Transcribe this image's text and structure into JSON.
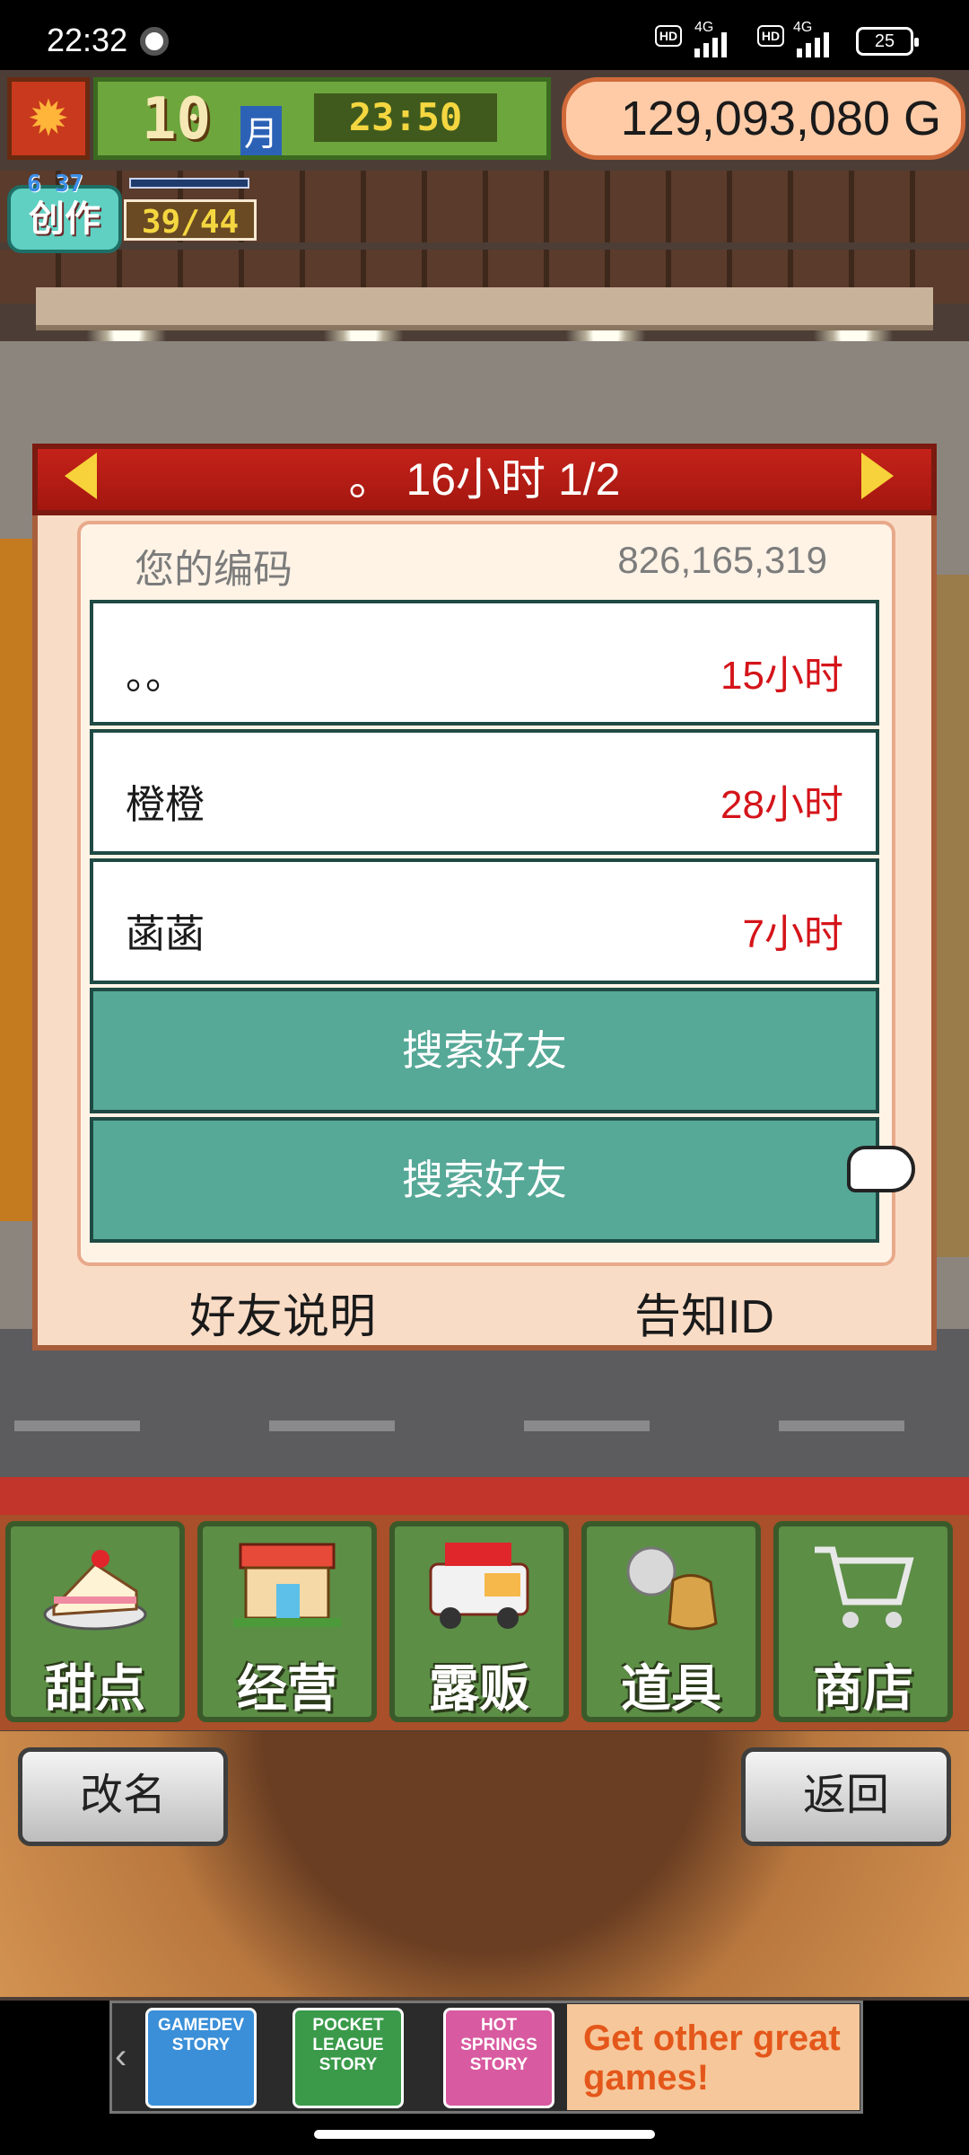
{
  "status_bar": {
    "time": "22:32",
    "network1": "4G",
    "network2": "4G",
    "hd1": "HD",
    "hd2": "HD",
    "battery": "25"
  },
  "hud": {
    "month": "10",
    "month_unit": "月",
    "clock": "23:50",
    "money": "129,093,080 G",
    "create_label": "创作",
    "create_mini": "6 37",
    "create_count": "39/44"
  },
  "dialog": {
    "title": "。 16小时 1/2",
    "code_label": "您的编码",
    "code_value": "826,165,319",
    "friends": [
      {
        "name": "。。",
        "hours": "15小时"
      },
      {
        "name": "橙橙",
        "hours": "28小时"
      },
      {
        "name": "菡菡",
        "hours": "7小时"
      }
    ],
    "search_label_1": "搜索好友",
    "search_label_2": "搜索好友",
    "friend_help": "好友说明",
    "notify_id": "告知ID"
  },
  "menu": {
    "items": [
      {
        "label": "甜点",
        "icon": "cake-icon"
      },
      {
        "label": "经营",
        "icon": "shop-icon"
      },
      {
        "label": "露贩",
        "icon": "food-truck-icon"
      },
      {
        "label": "道具",
        "icon": "items-icon"
      },
      {
        "label": "商店",
        "icon": "cart-icon"
      }
    ]
  },
  "bottom": {
    "rename": "改名",
    "back": "返回"
  },
  "ad": {
    "games": [
      "GAMEDEV STORY",
      "POCKET LEAGUE STORY",
      "HOT SPRINGS STORY"
    ],
    "more": "Get other great games!"
  },
  "colors": {
    "title_bar": "#c4221a",
    "search_button": "#56a897",
    "hours_red": "#d4141a",
    "menu_green": "#5c8e46"
  }
}
